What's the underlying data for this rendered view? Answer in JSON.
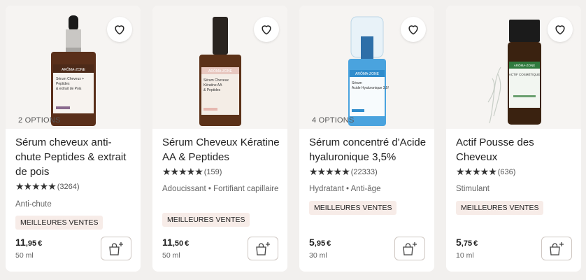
{
  "products": [
    {
      "options": "2 OPTIONS",
      "title": "Sérum cheveux anti-chute Peptides & extrait de pois",
      "stars": "★★★★★",
      "reviews": "(3264)",
      "desc": "Anti-chute",
      "badge": "MEILLEURES VENTES",
      "price_int": "11",
      "price_cents": ",95",
      "currency": "€",
      "size": "50 ml",
      "bottle_label": "ARÔMA-ZONE",
      "bottle_name": "Sérum Cheveux + Peptides & extrait de Pois"
    },
    {
      "options": "",
      "title": "Sérum Cheveux Kératine AA & Peptides",
      "stars": "★★★★★",
      "reviews": "(159)",
      "desc": "Adoucissant • Fortifiant capillaire",
      "badge": "MEILLEURES VENTES",
      "price_int": "11",
      "price_cents": ",50",
      "currency": "€",
      "size": "50 ml",
      "bottle_label": "ARÔMA-ZONE",
      "bottle_name": "Sérum Cheveux Kératine AA & Peptides"
    },
    {
      "options": "4 OPTIONS",
      "title": "Sérum concentré d'Acide hyaluronique 3,5%",
      "stars": "★★★★★",
      "reviews": "(22333)",
      "desc": "Hydratant • Anti-âge",
      "badge": "MEILLEURES VENTES",
      "price_int": "5",
      "price_cents": ",95",
      "currency": "€",
      "size": "30 ml",
      "bottle_label": "ARÔMA-ZONE",
      "bottle_name": "Sérum Acide Hyaluronique 3,5%"
    },
    {
      "options": "",
      "title": "Actif Pousse des Cheveux",
      "stars": "★★★★★",
      "reviews": "(636)",
      "desc": "Stimulant",
      "badge": "MEILLEURES VENTES",
      "price_int": "5",
      "price_cents": ",75",
      "currency": "€",
      "size": "10 ml",
      "bottle_label": "ARÔMA-ZONE",
      "bottle_name": "ACTIF COSMÉTIQUE"
    }
  ],
  "colors": {
    "accent_badge_bg": "#f7ece8",
    "bottle_amber": "#6b3a1f",
    "bottle_blue": "#3d8fd1",
    "bottle_green": "#2f6b3a"
  },
  "icons": {
    "favorite": "heart-outline-icon",
    "add_to_cart": "bag-plus-icon"
  }
}
